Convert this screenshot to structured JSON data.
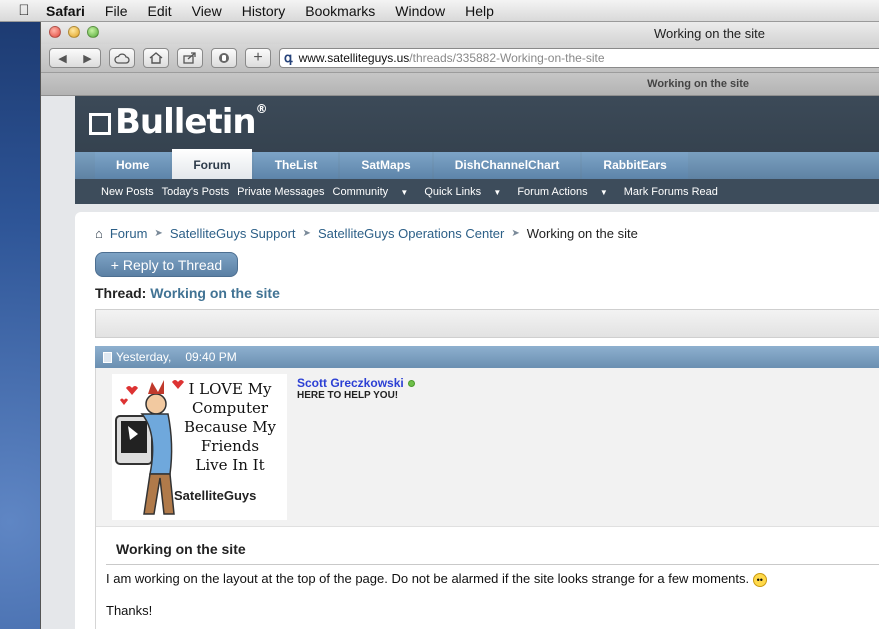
{
  "menubar": {
    "app": "Safari",
    "items": [
      "File",
      "Edit",
      "View",
      "History",
      "Bookmarks",
      "Window",
      "Help"
    ]
  },
  "window": {
    "title": "Working on the site",
    "url_host": "www.satelliteguys.us",
    "url_path": "/threads/335882-Working-on-the-site",
    "tab_title": "Working on the site"
  },
  "site": {
    "logo": "Bulletin",
    "logo_reg": "®",
    "nav_tabs": [
      "Home",
      "Forum",
      "TheList",
      "SatMaps",
      "DishChannelChart",
      "RabbitEars"
    ],
    "active_tab": "Forum",
    "subnav": [
      "New Posts",
      "Today's Posts",
      "Private Messages",
      "Community",
      "Quick Links",
      "Forum Actions",
      "Mark Forums Read"
    ],
    "breadcrumb": [
      "Forum",
      "SatelliteGuys Support",
      "SatelliteGuys Operations Center"
    ],
    "breadcrumb_current": "Working on the site",
    "reply_button": "+ Reply to Thread",
    "thread_label": "Thread:",
    "thread_title": "Working on the site"
  },
  "post": {
    "date": "Yesterday,",
    "time": "09:40 PM",
    "avatar_lines": [
      "I LOVE My",
      "Computer",
      "Because My",
      "Friends",
      "Live In It"
    ],
    "avatar_brand": "SatelliteGuys",
    "username": "Scott Greczkowski",
    "usertitle": "HERE TO HELP YOU!",
    "title": "Working on the site",
    "text": "I am working on the layout at the top of the page. Do not be alarmed if the site looks strange for a few moments.",
    "thanks": "Thanks!"
  },
  "colors": {
    "nav_blue": "#6a8fb1",
    "header_dark": "#2f3b47",
    "link_blue": "#2c5f87",
    "username_blue": "#2b3fd4"
  }
}
